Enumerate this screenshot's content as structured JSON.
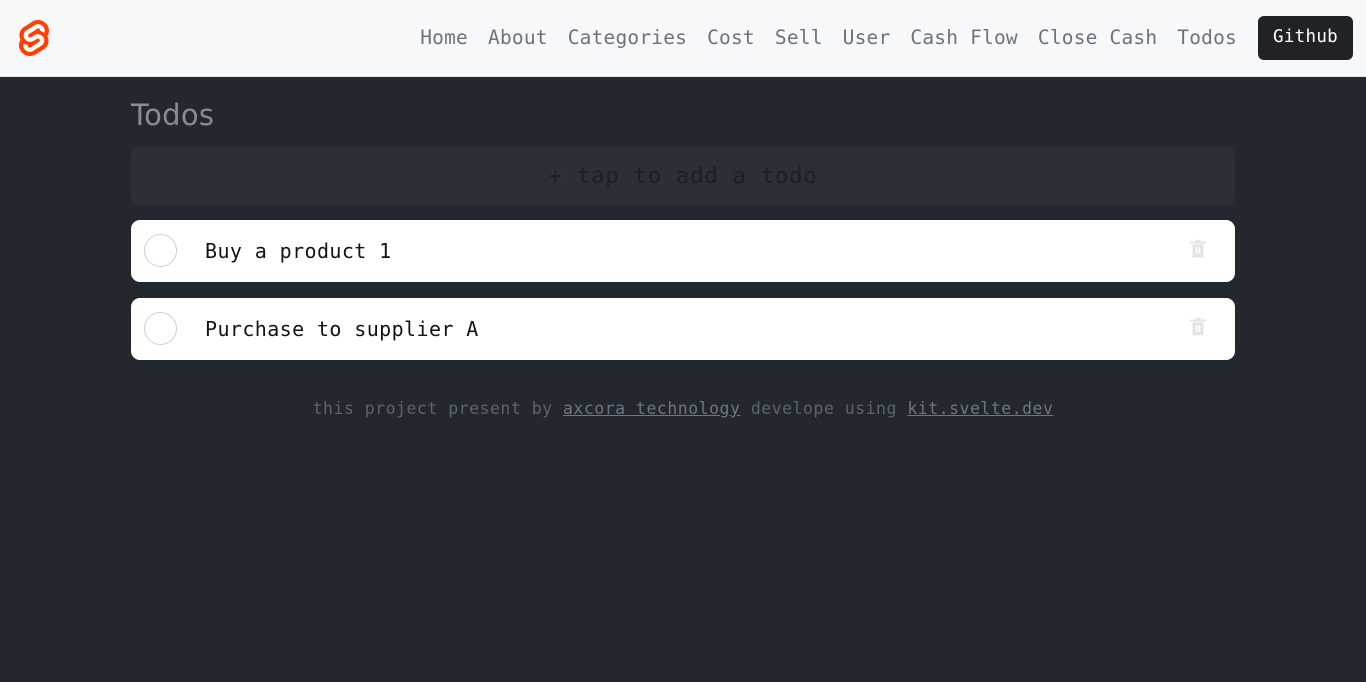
{
  "header": {
    "logo_icon": "svelte-logo-icon",
    "logo_color": "#ff3e00",
    "nav_items": [
      {
        "label": "Home"
      },
      {
        "label": "About"
      },
      {
        "label": "Categories"
      },
      {
        "label": "Cost"
      },
      {
        "label": "Sell"
      },
      {
        "label": "User"
      },
      {
        "label": "Cash Flow"
      },
      {
        "label": "Close Cash"
      },
      {
        "label": "Todos"
      }
    ],
    "github_button": {
      "label": "Github",
      "background": "#1f2328",
      "text_color": "#ffffff"
    },
    "background": "#f7f8fa"
  },
  "main": {
    "title": "Todos",
    "add_button": {
      "label": "+ tap to add a todo",
      "background": "#2b2f36",
      "text_color": "#1c2026"
    },
    "todos": [
      {
        "label": "Buy a product 1",
        "checked": false,
        "delete_icon": "trash-icon"
      },
      {
        "label": "Purchase to supplier A",
        "checked": false,
        "delete_icon": "trash-icon"
      }
    ],
    "background": "#23272e"
  },
  "footer": {
    "text_before": "this project present by ",
    "link1": "axcora technology",
    "text_middle": " develope using ",
    "link2": "kit.svelte.dev",
    "text_color": "#5c6470"
  }
}
